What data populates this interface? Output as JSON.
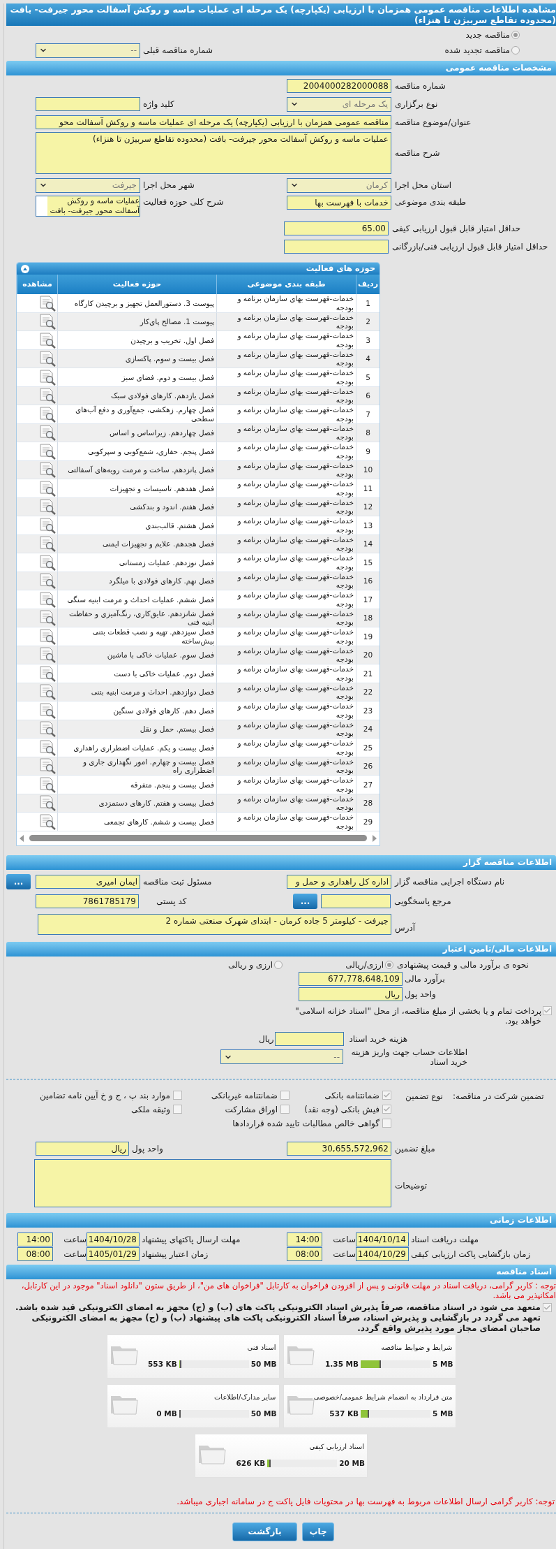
{
  "title": "مشاهده اطلاعات مناقصه عمومی همزمان با ارزیابی (یکپارچه) یک مرحله ای عملیات ماسه و روکش آسفالت محور جیرفت- بافت (محدوده تقاطع سربیژن تا هنزاء)",
  "tender_kind": [
    {
      "label": "مناقصه جدید",
      "selected": true
    },
    {
      "label": "مناقصه تجدید شده",
      "selected": false
    }
  ],
  "previous_tender": {
    "label": "شماره مناقصه قبلی",
    "value": "--"
  },
  "general": {
    "header": "مشخصات مناقصه عمومی",
    "tender_number": {
      "label": "شماره مناقصه",
      "value": "2004000282000088"
    },
    "holding_type": {
      "label": "نوع برگزاری",
      "value": "یک مرحله ای"
    },
    "keyword": {
      "label": "کلید واژه"
    },
    "subject": {
      "label": "عنوان/موضوع مناقصه",
      "value": "مناقصه عمومی همزمان با ارزیابی (یکپارچه) یک مرحله ای عملیات ماسه و روکش آسفالت محو"
    },
    "description": {
      "label": "شرح مناقصه",
      "value": "عملیات ماسه و روکش آسفالت محور جیرفت- بافت (محدوده تقاطع سربیژن تا هنزاء)"
    },
    "province": {
      "label": "استان محل اجرا",
      "value": "کرمان"
    },
    "city": {
      "label": "شهر محل اجرا",
      "value": "جیرفت"
    },
    "category": {
      "label": "طبقه بندی موضوعی",
      "value": "خدمات با فهرست بها"
    },
    "activity_summary": {
      "label": "شرح کلی حوزه فعالیت",
      "value": "عملیات ماسه و روکش آسفالت محور جیرفت- بافت"
    },
    "min_quality_score": {
      "label": "حداقل امتیاز قابل قبول ارزیابی کیفی",
      "value": "65.00"
    },
    "min_technical_score": {
      "label": "حداقل امتیاز قابل قبول ارزیابی فنی/بازرگانی"
    }
  },
  "activities": {
    "title": "حوزه های فعالیت",
    "columns": [
      "ردیف",
      "طبقه بندی موضوعی",
      "حوزه فعالیت",
      "مشاهده"
    ],
    "rows": [
      {
        "number": "1",
        "category": "خدمات-فهرست بهای سازمان برنامه و بودجه",
        "activity": "پیوست 3. دستورالعمل تجهیز و برچیدن کارگاه"
      },
      {
        "number": "2",
        "category": "خدمات-فهرست بهای سازمان برنامه و بودجه",
        "activity": "پیوست 1. مصالح پای‌کار"
      },
      {
        "number": "3",
        "category": "خدمات-فهرست بهای سازمان برنامه و بودجه",
        "activity": "فصل اول. تخریب و برچیدن"
      },
      {
        "number": "4",
        "category": "خدمات-فهرست بهای سازمان برنامه و بودجه",
        "activity": "فصل بیست و سوم. پاکسازی"
      },
      {
        "number": "5",
        "category": "خدمات-فهرست بهای سازمان برنامه و بودجه",
        "activity": "فصل بیست و دوم. فضای سبز"
      },
      {
        "number": "6",
        "category": "خدمات-فهرست بهای سازمان برنامه و بودجه",
        "activity": "فصل یازدهم. کارهای فولادی سبک"
      },
      {
        "number": "7",
        "category": "خدمات-فهرست بهای سازمان برنامه و بودجه",
        "activity": "فصل چهارم. زهکشی، جمع‌آوری و دفع آب‌های سطحی"
      },
      {
        "number": "8",
        "category": "خدمات-فهرست بهای سازمان برنامه و بودجه",
        "activity": "فصل چهاردهم. زیراساس و اساس"
      },
      {
        "number": "9",
        "category": "خدمات-فهرست بهای سازمان برنامه و بودجه",
        "activity": "فصل پنجم. حفاری، شمع‌کوبی و سپرکوبی"
      },
      {
        "number": "10",
        "category": "خدمات-فهرست بهای سازمان برنامه و بودجه",
        "activity": "فصل پانزدهم. ساخت و مرمت رویه‌های آسفالتی"
      },
      {
        "number": "11",
        "category": "خدمات-فهرست بهای سازمان برنامه و بودجه",
        "activity": "فصل هفدهم. تاسیسات و تجهیزات"
      },
      {
        "number": "12",
        "category": "خدمات-فهرست بهای سازمان برنامه و بودجه",
        "activity": "فصل هفتم. اندود و بندکشی"
      },
      {
        "number": "13",
        "category": "خدمات-فهرست بهای سازمان برنامه و بودجه",
        "activity": "فصل هشتم. قالب‌بندی"
      },
      {
        "number": "14",
        "category": "خدمات-فهرست بهای سازمان برنامه و بودجه",
        "activity": "فصل هجدهم. علایم و تجهیزات ایمنی"
      },
      {
        "number": "15",
        "category": "خدمات-فهرست بهای سازمان برنامه و بودجه",
        "activity": "فصل نوزدهم. عملیات زمستانی"
      },
      {
        "number": "16",
        "category": "خدمات-فهرست بهای سازمان برنامه و بودجه",
        "activity": "فصل نهم. کارهای فولادی با میلگرد"
      },
      {
        "number": "17",
        "category": "خدمات-فهرست بهای سازمان برنامه و بودجه",
        "activity": "فصل ششم. عملیات احداث و مرمت ابنیه سنگی"
      },
      {
        "number": "18",
        "category": "خدمات-فهرست بهای سازمان برنامه و بودجه",
        "activity": "فصل شانزدهم. عایق‌کاری، رنگ‌آمیزی و حفاظت ابنیه فنی"
      },
      {
        "number": "19",
        "category": "خدمات-فهرست بهای سازمان برنامه و بودجه",
        "activity": "فصل سیزدهم. تهیه و نصب قطعات بتنی پیش‌ساخته"
      },
      {
        "number": "20",
        "category": "خدمات-فهرست بهای سازمان برنامه و بودجه",
        "activity": "فصل سوم. عملیات خاکی با ماشین"
      },
      {
        "number": "21",
        "category": "خدمات-فهرست بهای سازمان برنامه و بودجه",
        "activity": "فصل دوم. عملیات خاکی با دست"
      },
      {
        "number": "22",
        "category": "خدمات-فهرست بهای سازمان برنامه و بودجه",
        "activity": "فصل دوازدهم. احداث و مرمت ابنیه بتنی"
      },
      {
        "number": "23",
        "category": "خدمات-فهرست بهای سازمان برنامه و بودجه",
        "activity": "فصل دهم. کارهای فولادی سنگین"
      },
      {
        "number": "24",
        "category": "خدمات-فهرست بهای سازمان برنامه و بودجه",
        "activity": "فصل بیستم. حمل و نقل"
      },
      {
        "number": "25",
        "category": "خدمات-فهرست بهای سازمان برنامه و بودجه",
        "activity": "فصل بیست و یکم. عملیات اضطراری راهداری"
      },
      {
        "number": "26",
        "category": "خدمات-فهرست بهای سازمان برنامه و بودجه",
        "activity": "فصل بیست و چهارم. امور نگهداری جاری و اضطراری راه"
      },
      {
        "number": "27",
        "category": "خدمات-فهرست بهای سازمان برنامه و بودجه",
        "activity": "فصل بیست و پنجم. متفرقه"
      },
      {
        "number": "28",
        "category": "خدمات-فهرست بهای سازمان برنامه و بودجه",
        "activity": "فصل بیست و هفتم. کارهای دستمزدی"
      },
      {
        "number": "29",
        "category": "خدمات-فهرست بهای سازمان برنامه و بودجه",
        "activity": "فصل بیست و ششم. کارهای تجمعی"
      }
    ]
  },
  "organizer": {
    "header": "اطلاعات مناقصه گزار",
    "agency": {
      "label": "نام دستگاه اجرایی مناقصه گزار",
      "value": "اداره کل راهداری و حمل و"
    },
    "registrar": {
      "label": "مسئول ثبت مناقصه",
      "value": "ایمان امیری",
      "button": "..."
    },
    "reference": {
      "label": "مرجع پاسخگویی",
      "button": "..."
    },
    "postal_code": {
      "label": "کد پستی",
      "value": "7861785179"
    },
    "address": {
      "label": "آدرس",
      "value": "جیرفت - کیلومتر 5 جاده کرمان - ابتدای شهرک صنعتی شماره 2"
    }
  },
  "financial": {
    "header": "اطلاعات مالی/تامین اعتبار",
    "pricing": {
      "label": "نحوه ی برآورد مالی و قیمت پیشنهادی",
      "options": [
        {
          "label": "ارزی/ریالی",
          "selected": true
        },
        {
          "label": "ارزی و ریالی",
          "selected": false
        }
      ]
    },
    "estimate": {
      "label": "برآورد مالی",
      "value": "677,778,648,109"
    },
    "currency": {
      "label": "واحد پول",
      "value": "ریال"
    },
    "treasury": {
      "label": "پرداخت تمام و یا بخشی از مبلغ مناقصه، از محل \"اسناد خزانه اسلامی\" خواهد بود.",
      "checked": true
    },
    "document_fee": {
      "label": "هزینه خرید اسناد",
      "unit": "ریال"
    },
    "fee_account": {
      "label": "اطلاعات حساب جهت واریز هزینه خرید اسناد",
      "value": "--"
    }
  },
  "guarantee": {
    "label": "تضمین شرکت در مناقصه:",
    "type_label": "نوع تضمین",
    "options": [
      {
        "label": "ضمانتنامه بانکی",
        "checked": true
      },
      {
        "label": "ضمانتنامه غیربانکی",
        "checked": false
      },
      {
        "label": "موارد بند پ ، ج و خ آیین نامه تضامین",
        "checked": false
      },
      {
        "label": "فیش بانکی (وجه نقد)",
        "checked": true
      },
      {
        "label": "اوراق مشارکت",
        "checked": false
      },
      {
        "label": "وثیقه ملکی",
        "checked": false
      },
      {
        "label": "گواهی خالص مطالبات تایید شده قراردادها",
        "checked": false
      }
    ],
    "amount": {
      "label": "مبلغ تضمین",
      "value": "30,655,572,962"
    },
    "currency": {
      "label": "واحد پول",
      "value": "ریال"
    },
    "notes": {
      "label": "توضیحات"
    }
  },
  "schedule": {
    "header": "اطلاعات زمانی",
    "items": [
      {
        "label": "مهلت دریافت اسناد",
        "date": "1404/10/14",
        "time_label": "ساعت",
        "time": "14:00"
      },
      {
        "label": "مهلت ارسال پاکتهای پیشنهاد",
        "date": "1404/10/28",
        "time_label": "ساعت",
        "time": "14:00"
      },
      {
        "label": "زمان بازگشایی پاکت ارزیابی کیفی",
        "date": "1404/10/29",
        "time_label": "ساعت",
        "time": "08:00"
      },
      {
        "label": "زمان اعتبار پیشنهاد",
        "date": "1405/01/29",
        "time_label": "ساعت",
        "time": "08:00"
      }
    ]
  },
  "documents": {
    "header": "اسناد مناقصه",
    "notice": "توجه : کاربر گرامی، دریافت اسناد در مهلت قانونی و پس از افزودن فراخوان به کارتابل \"فراخوان های من\"، از طریق ستون \"دانلود اسناد\" موجود در این کارتابل، امکانپذیر می باشد.",
    "commitment": {
      "text": "متعهد می شود در اسناد مناقصه، صرفاً پذیرش اسناد الکترونیکی پاکت های (ب) و (ج) مجهز به امضای الکترونیکی قید شده باشد. تعهد می گردد در بازگشایی و پذیرش اسناد، صرفاً اسناد الکترونیکی پاکت های پیشنهاد (ب) و (ج) مجهز به امضای الکترونیکی صاحبان امضای مجاز مورد پذیرش واقع گردد.",
      "checked": true
    },
    "files": [
      {
        "title": "شرایط و ضوابط مناقصه",
        "size": "1.35 MB",
        "limit": "5 MB",
        "level": 0.27
      },
      {
        "title": "اسناد فنی",
        "size": "553 KB",
        "limit": "50 MB",
        "level": 0.011
      },
      {
        "title": "متن قرارداد به انضمام شرایط عمومی/خصوصی",
        "size": "537 KB",
        "limit": "5 MB",
        "level": 0.105
      },
      {
        "title": "سایر مدارک/اطلاعات",
        "size": "0 MB",
        "limit": "50 MB",
        "level": 0
      },
      {
        "title": "اسناد ارزیابی کیفی",
        "size": "626 KB",
        "limit": "20 MB",
        "level": 0.031
      }
    ],
    "note": "توجه: کاربر گرامی ارسال اطلاعات مربوط به فهرست بها در محتویات فایل پاکت ج در سامانه اجباری میباشد."
  },
  "buttons": [
    {
      "label": "چاپ"
    },
    {
      "label": "بازگشت"
    }
  ]
}
